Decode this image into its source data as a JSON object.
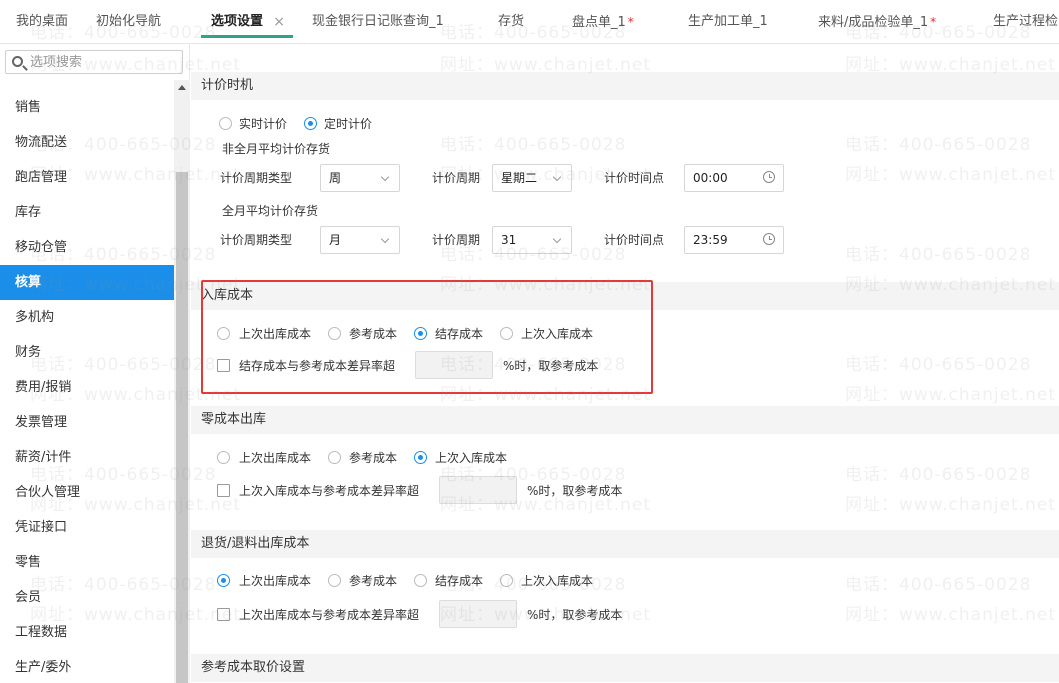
{
  "tabs": [
    {
      "label": "我的桌面",
      "active": false,
      "starred": false
    },
    {
      "label": "初始化导航",
      "active": false,
      "starred": false
    },
    {
      "label": "选项设置",
      "active": true,
      "starred": false
    },
    {
      "label": "现金银行日记账查询_1",
      "active": false,
      "starred": false
    },
    {
      "label": "存货",
      "active": false,
      "starred": false
    },
    {
      "label": "盘点单_1",
      "active": false,
      "starred": true
    },
    {
      "label": "生产加工单_1",
      "active": false,
      "starred": false
    },
    {
      "label": "来料/成品检验单_1",
      "active": false,
      "starred": true
    },
    {
      "label": "生产过程检",
      "active": false,
      "starred": false
    }
  ],
  "tab_close_glyph": "×",
  "tab_star_glyph": "*",
  "sidebar": {
    "search_placeholder": "选项搜索",
    "items": [
      "销售",
      "物流配送",
      "跑店管理",
      "库存",
      "移动仓管",
      "核算",
      "多机构",
      "财务",
      "费用/报销",
      "发票管理",
      "薪资/计件",
      "合伙人管理",
      "凭证接口",
      "零售",
      "会员",
      "工程数据",
      "生产/委外"
    ],
    "active_index": 5
  },
  "pricing_timing": {
    "title": "计价时机",
    "options": [
      {
        "label": "实时计价",
        "checked": false
      },
      {
        "label": "定时计价",
        "checked": true
      }
    ],
    "non_full_month": {
      "title": "非全月平均计价存货",
      "period_type_label": "计价周期类型",
      "period_type_value": "周",
      "period_label": "计价周期",
      "period_value": "星期二",
      "time_label": "计价时间点",
      "time_value": "00:00"
    },
    "full_month": {
      "title": "全月平均计价存货",
      "period_type_label": "计价周期类型",
      "period_type_value": "月",
      "period_label": "计价周期",
      "period_value": "31",
      "time_label": "计价时间点",
      "time_value": "23:59"
    }
  },
  "inbound_cost": {
    "title": "入库成本",
    "options": [
      {
        "label": "上次出库成本",
        "checked": false
      },
      {
        "label": "参考成本",
        "checked": false
      },
      {
        "label": "结存成本",
        "checked": true
      },
      {
        "label": "上次入库成本",
        "checked": false
      }
    ],
    "check_label": "结存成本与参考成本差异率超",
    "suffix": "%时，取参考成本"
  },
  "zero_cost_outbound": {
    "title": "零成本出库",
    "options": [
      {
        "label": "上次出库成本",
        "checked": false
      },
      {
        "label": "参考成本",
        "checked": false
      },
      {
        "label": "上次入库成本",
        "checked": true
      }
    ],
    "check_label": "上次入库成本与参考成本差异率超",
    "suffix": "%时，取参考成本"
  },
  "return_outbound": {
    "title": "退货/退料出库成本",
    "options": [
      {
        "label": "上次出库成本",
        "checked": true
      },
      {
        "label": "参考成本",
        "checked": false
      },
      {
        "label": "结存成本",
        "checked": false
      },
      {
        "label": "上次入库成本",
        "checked": false
      }
    ],
    "check_label": "上次出库成本与参考成本差异率超",
    "suffix": "%时，取参考成本"
  },
  "reference_cost": {
    "title": "参考成本取价设置"
  },
  "watermark": {
    "phone": "电话：400-665-0028",
    "site": "网址：www.chanjet.net"
  },
  "colors": {
    "accent": "#1a8ee8",
    "tab_underline": "#2aa58a",
    "highlight": "#e53935",
    "star": "#e0302c"
  }
}
